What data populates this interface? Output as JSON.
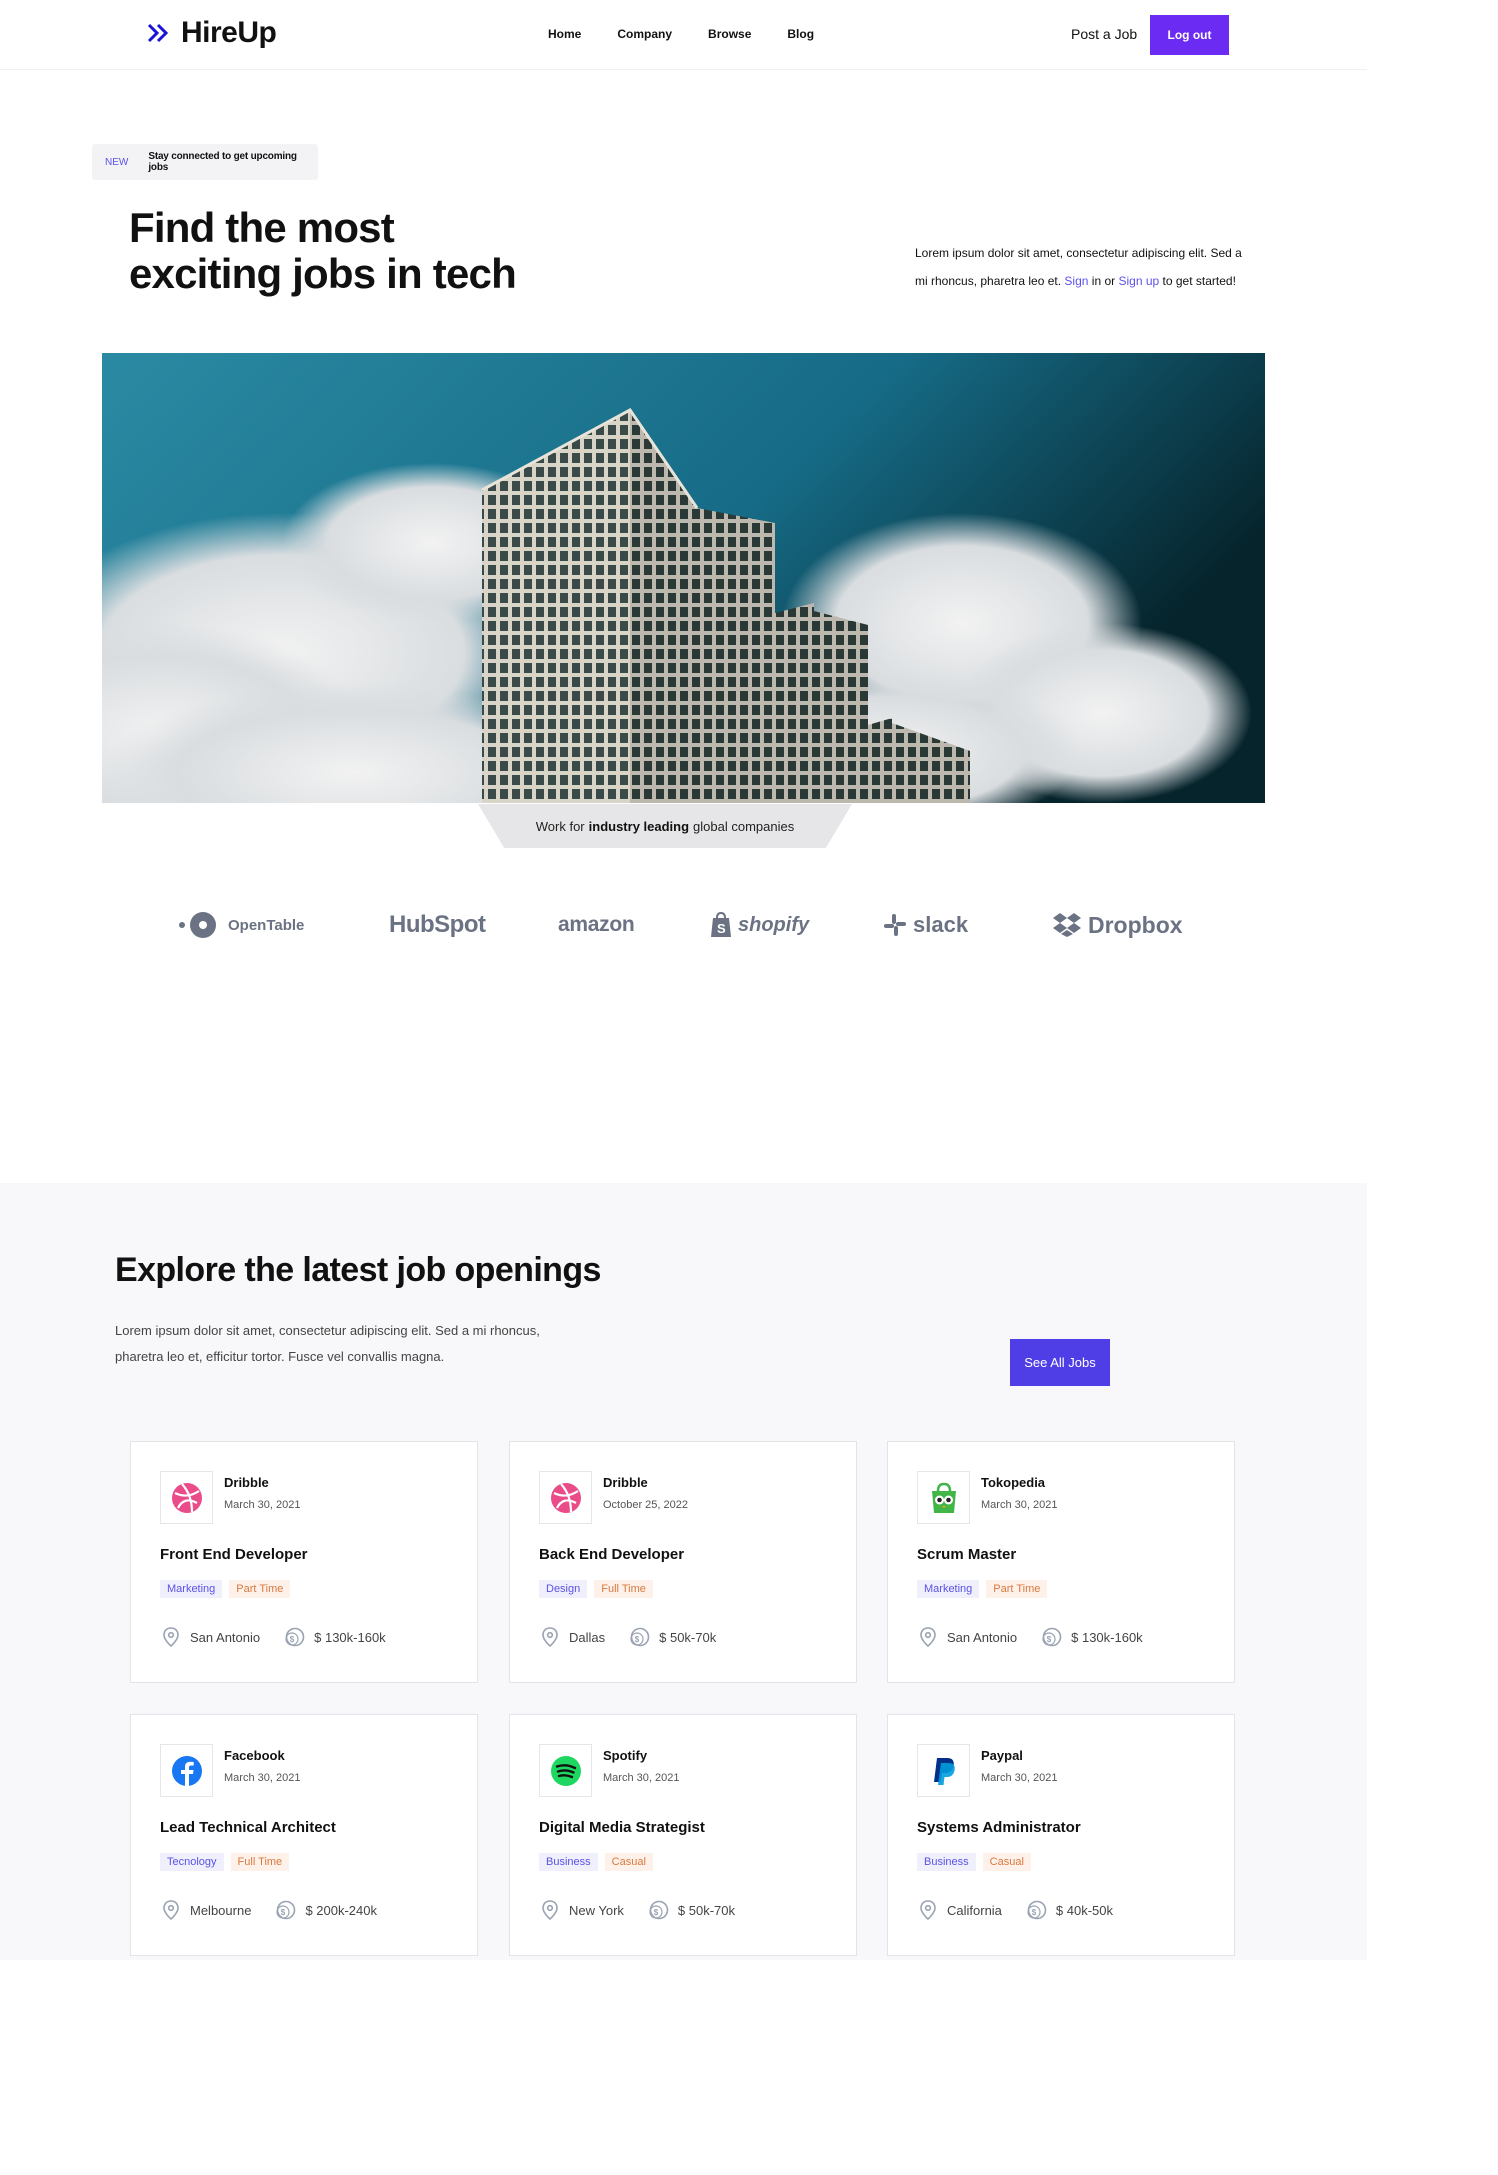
{
  "nav": {
    "brand": "HireUp",
    "links": [
      "Home",
      "Company",
      "Browse",
      "Blog"
    ],
    "post_job": "Post a Job",
    "logout": "Log out",
    "accent": "#6c2bf2"
  },
  "hero": {
    "badge_new": "NEW",
    "badge_text": "Stay connected to get upcoming jobs",
    "title_line1": "Find the most",
    "title_line2": "exciting jobs in tech",
    "desc_before": "Lorem ipsum dolor sit amet, consectetur adipiscing elit. Sed a mi rhoncus, pharetra leo et.",
    "sign_in": "Sign",
    "desc_mid1": "in or",
    "sign_up": "Sign up",
    "desc_after": "to get started!",
    "ribbon_before": "Work for",
    "ribbon_bold": "industry leading",
    "ribbon_after": "global companies"
  },
  "brands": [
    "OpenTable",
    "HubSpot",
    "amazon",
    "shopify",
    "slack",
    "Dropbox"
  ],
  "jobs": {
    "title": "Explore the latest job openings",
    "desc": "Lorem ipsum dolor sit amet, consectetur adipiscing elit. Sed a mi rhoncus, pharetra leo et, efficitur tortor. Fusce vel convallis magna.",
    "see_all": "See All Jobs",
    "cards": [
      {
        "company": "Dribble",
        "date": "March 30, 2021",
        "role": "Front End Developer",
        "category": "Marketing",
        "type": "Part Time",
        "location": "San Antonio",
        "salary": "$ 130k-160k",
        "icon": "dribbble-icon"
      },
      {
        "company": "Dribble",
        "date": "October 25, 2022",
        "role": "Back End Developer",
        "category": "Design",
        "type": "Full Time",
        "location": "Dallas",
        "salary": "$ 50k-70k",
        "icon": "dribbble-icon"
      },
      {
        "company": "Tokopedia",
        "date": "March 30, 2021",
        "role": "Scrum Master",
        "category": "Marketing",
        "type": "Part Time",
        "location": "San Antonio",
        "salary": "$ 130k-160k",
        "icon": "tokopedia-icon"
      },
      {
        "company": "Facebook",
        "date": "March 30, 2021",
        "role": "Lead Technical Architect",
        "category": "Tecnology",
        "type": "Full Time",
        "location": "Melbourne",
        "salary": "$ 200k-240k",
        "icon": "facebook-icon"
      },
      {
        "company": "Spotify",
        "date": "March 30, 2021",
        "role": "Digital Media Strategist",
        "category": "Business",
        "type": "Casual",
        "location": "New York",
        "salary": "$ 50k-70k",
        "icon": "spotify-icon"
      },
      {
        "company": "Paypal",
        "date": "March 30, 2021",
        "role": "Systems Administrator",
        "category": "Business",
        "type": "Casual",
        "location": "California",
        "salary": "$ 40k-50k",
        "icon": "paypal-icon"
      }
    ]
  }
}
